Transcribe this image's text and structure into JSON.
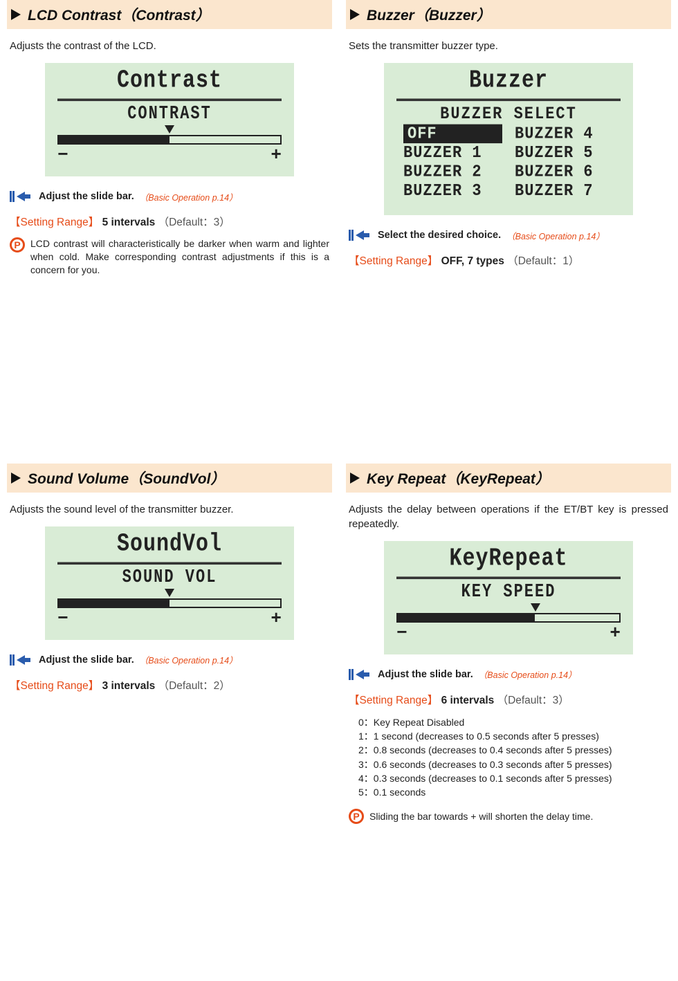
{
  "sections": {
    "contrast": {
      "title": "LCD Contrast（Contrast）",
      "desc": "Adjusts the contrast of the LCD.",
      "lcdTitle": "Contrast",
      "lcdLabel": "CONTRAST",
      "hint": "Adjust the slide bar.",
      "hintRef": "（Basic Operation p.14）",
      "rangeLabel": "【Setting Range】",
      "rangeVal": "5 intervals",
      "rangeDef": "（Default：3）",
      "noteP": "P",
      "noteText": "LCD contrast will characteristically be darker when warm and lighter when cold. Make corresponding contrast adjustments if this is a concern for you."
    },
    "buzzer": {
      "title": "Buzzer（Buzzer）",
      "desc": "Sets the transmitter buzzer type.",
      "lcdTitle": "Buzzer",
      "lcdSub": "BUZZER SELECT",
      "opts": [
        "OFF",
        "BUZZER 1",
        "BUZZER 2",
        "BUZZER 3",
        "BUZZER 4",
        "BUZZER 5",
        "BUZZER 6",
        "BUZZER 7"
      ],
      "hint": "Select the desired choice.",
      "hintRef": "（Basic Operation p.14）",
      "rangeLabel": "【Setting Range】",
      "rangeVal": "OFF, 7 types",
      "rangeDef": "（Default：1）"
    },
    "soundvol": {
      "title": "Sound Volume（SoundVol）",
      "desc": "Adjusts the sound level of the transmitter buzzer.",
      "lcdTitle": "SoundVol",
      "lcdLabel": "SOUND VOL",
      "hint": "Adjust the slide bar.",
      "hintRef": "（Basic Operation p.14）",
      "rangeLabel": "【Setting Range】",
      "rangeVal": "3 intervals",
      "rangeDef": "（Default：2）"
    },
    "keyrepeat": {
      "title": "Key Repeat（KeyRepeat）",
      "desc": "Adjusts the delay between operations if the ET/BT key is pressed repeatedly.",
      "lcdTitle": "KeyRepeat",
      "lcdLabel": "KEY SPEED",
      "hint": "Adjust the slide bar.",
      "hintRef": "（Basic Operation p.14）",
      "rangeLabel": "【Setting Range】",
      "rangeVal": "6 intervals",
      "rangeDef": "（Default：3）",
      "list": [
        "0：Key Repeat Disabled",
        "1：1 second (decreases to 0.5 seconds after 5 presses)",
        "2：0.8 seconds (decreases to 0.4 seconds after 5 presses)",
        "3：0.6 seconds (decreases to 0.3 seconds after 5 presses)",
        "4：0.3 seconds (decreases to 0.1 seconds after 5 presses)",
        "5：0.1 seconds"
      ],
      "noteP": "P",
      "noteText": "Sliding the bar towards + will shorten the delay time."
    }
  },
  "slideEnds": {
    "minus": "−",
    "plus": "+"
  }
}
